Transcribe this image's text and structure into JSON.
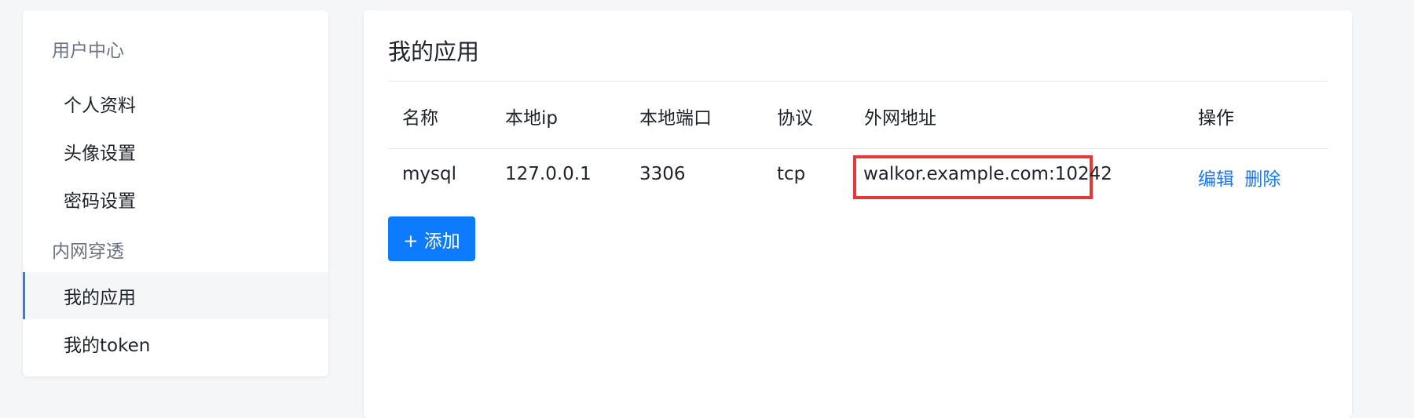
{
  "sidebar": {
    "groups": [
      {
        "title": "用户中心",
        "items": [
          "个人资料",
          "头像设置",
          "密码设置"
        ]
      },
      {
        "title": "内网穿透",
        "items": [
          "我的应用",
          "我的token"
        ]
      }
    ]
  },
  "main": {
    "title": "我的应用",
    "table": {
      "headers": [
        "名称",
        "本地ip",
        "本地端口",
        "协议",
        "外网地址",
        "操作"
      ],
      "rows": [
        {
          "name": "mysql",
          "local_ip": "127.0.0.1",
          "local_port": "3306",
          "protocol": "tcp",
          "public_address": "walkor.example.com:10242",
          "edit": "编辑",
          "delete": "删除"
        }
      ]
    },
    "add_button": "+ 添加"
  },
  "colors": {
    "accent": "#0d7bff",
    "link": "#1677ff",
    "highlight": "#e5383b"
  }
}
